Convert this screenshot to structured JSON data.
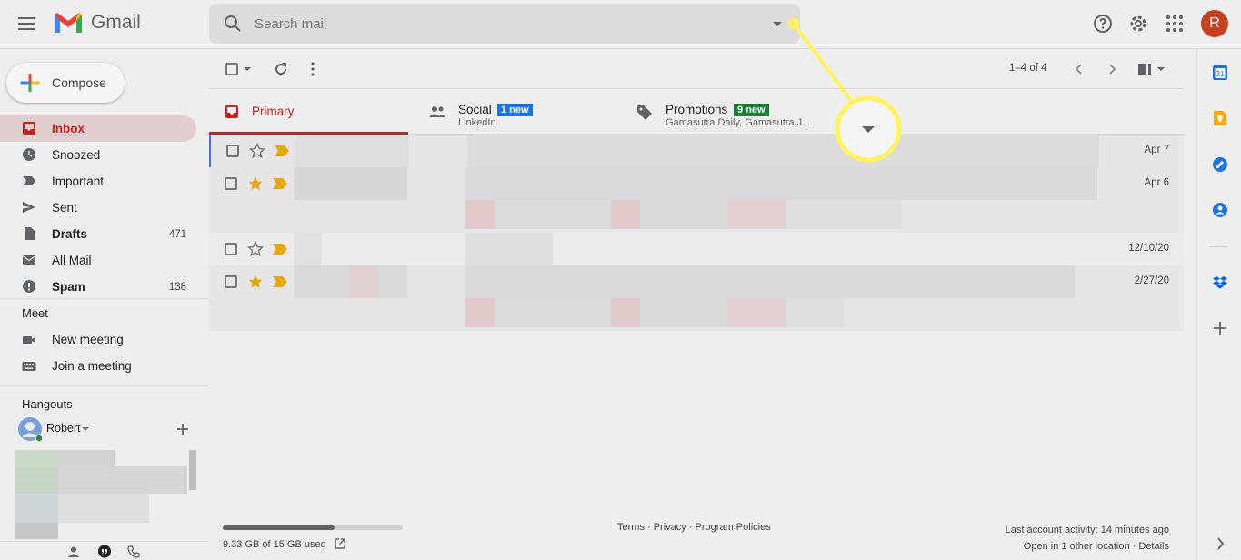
{
  "app": {
    "name": "Gmail",
    "avatar_letter": "R"
  },
  "search": {
    "placeholder": "Search mail"
  },
  "compose": {
    "label": "Compose"
  },
  "nav": [
    {
      "label": "Inbox",
      "count": ""
    },
    {
      "label": "Snoozed",
      "count": ""
    },
    {
      "label": "Important",
      "count": ""
    },
    {
      "label": "Sent",
      "count": ""
    },
    {
      "label": "Drafts",
      "count": "471"
    },
    {
      "label": "All Mail",
      "count": ""
    },
    {
      "label": "Spam",
      "count": "138"
    }
  ],
  "meet": {
    "title": "Meet",
    "new_meeting": "New meeting",
    "join_meeting": "Join a meeting"
  },
  "hangouts": {
    "title": "Hangouts",
    "user": "Robert"
  },
  "toolbar": {
    "range": "1–4 of 4"
  },
  "tabs": {
    "primary": {
      "label": "Primary"
    },
    "social": {
      "label": "Social",
      "badge": "1 new",
      "sub": "LinkedIn"
    },
    "promotions": {
      "label": "Promotions",
      "badge": "9 new",
      "sub": "Gamasutra Daily, Gamasutra J..."
    }
  },
  "emails": [
    {
      "date": "Apr 7",
      "starred": false
    },
    {
      "date": "Apr 6",
      "starred": true
    },
    {
      "date": "12/10/20",
      "starred": false
    },
    {
      "date": "2/27/20",
      "starred": true
    }
  ],
  "footer": {
    "storage": "9.33 GB of 15 GB used",
    "storage_fraction": 0.62,
    "links": "Terms · Privacy · Program Policies",
    "activity": "Last account activity: 14 minutes ago",
    "location": "Open in 1 other location · Details"
  },
  "colors": {
    "accent": "#c5221f",
    "highlight": "#fff35c",
    "social_badge": "#1a73e8",
    "promo_badge": "#188038"
  }
}
